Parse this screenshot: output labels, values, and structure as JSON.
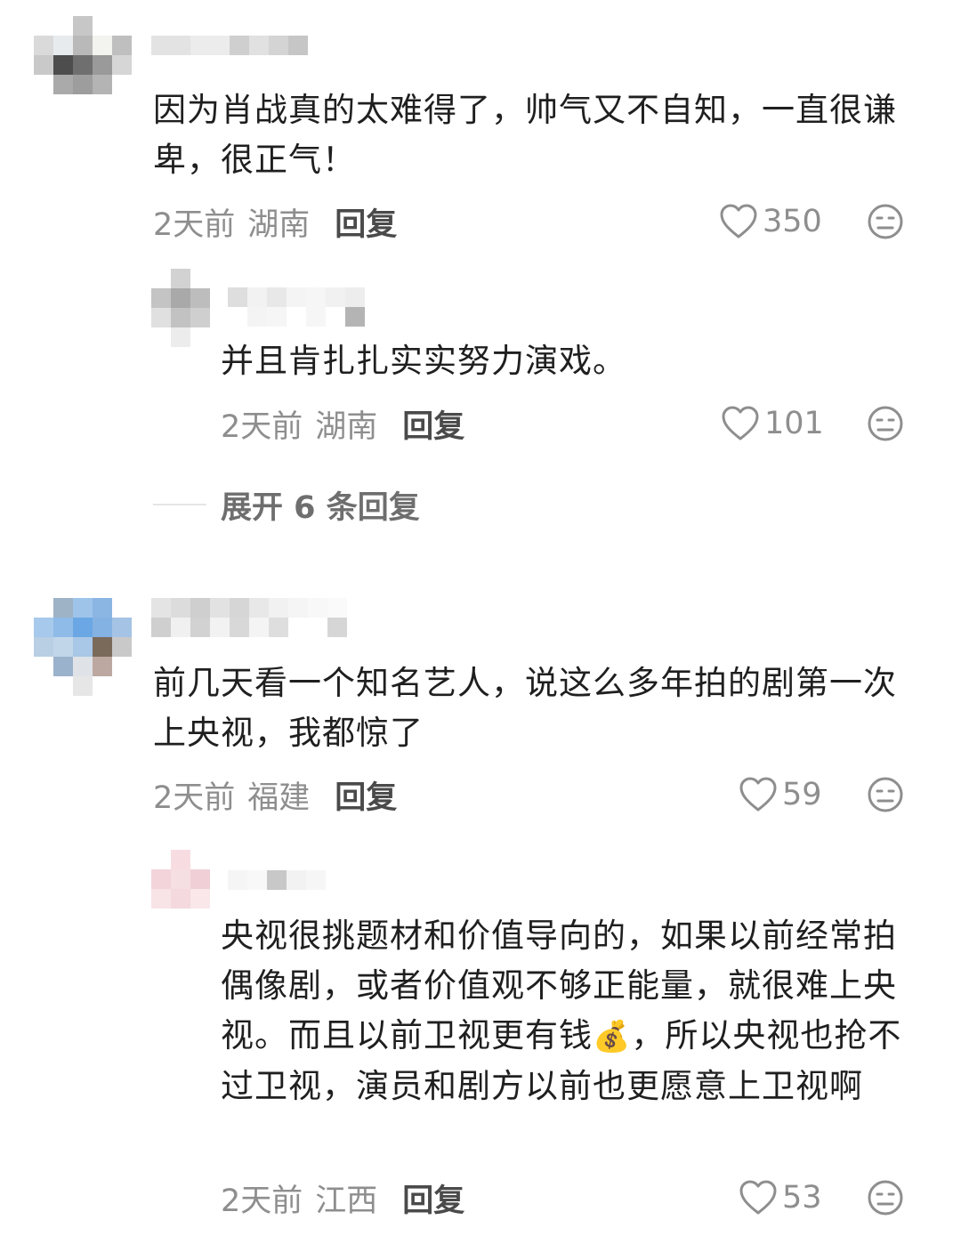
{
  "comments": [
    {
      "text": "因为肖战真的太难得了，帅气又不自知，一直很谦卑，很正气！",
      "time": "2天前",
      "location": "湖南",
      "reply_label": "回复",
      "likes": "350"
    },
    {
      "text": "并且肯扎扎实实努力演戏。",
      "time": "2天前",
      "location": "湖南",
      "reply_label": "回复",
      "likes": "101"
    },
    {
      "text": "前几天看一个知名艺人，说这么多年拍的剧第一次上央视，我都惊了",
      "time": "2天前",
      "location": "福建",
      "reply_label": "回复",
      "likes": "59"
    },
    {
      "text_part1": "央视很挑题材和价值导向的，如果以前经常拍偶像剧，或者价值观不够正能量，就很难上央视。而且以前卫视更有钱",
      "emoji": "💰",
      "text_part2": "，所以央视也抢不过卫视，演员和剧方以前也更愿意上卫视啊",
      "time": "2天前",
      "location": "江西",
      "reply_label": "回复",
      "likes": "53"
    }
  ],
  "expand_replies": "展开 6 条回复",
  "icons": {
    "like": "heart-outline-icon",
    "dislike": "dislike-face-icon"
  },
  "colors": {
    "text": "#1f1f1f",
    "meta": "#8e8e8e",
    "reply": "#4a4a4a"
  }
}
